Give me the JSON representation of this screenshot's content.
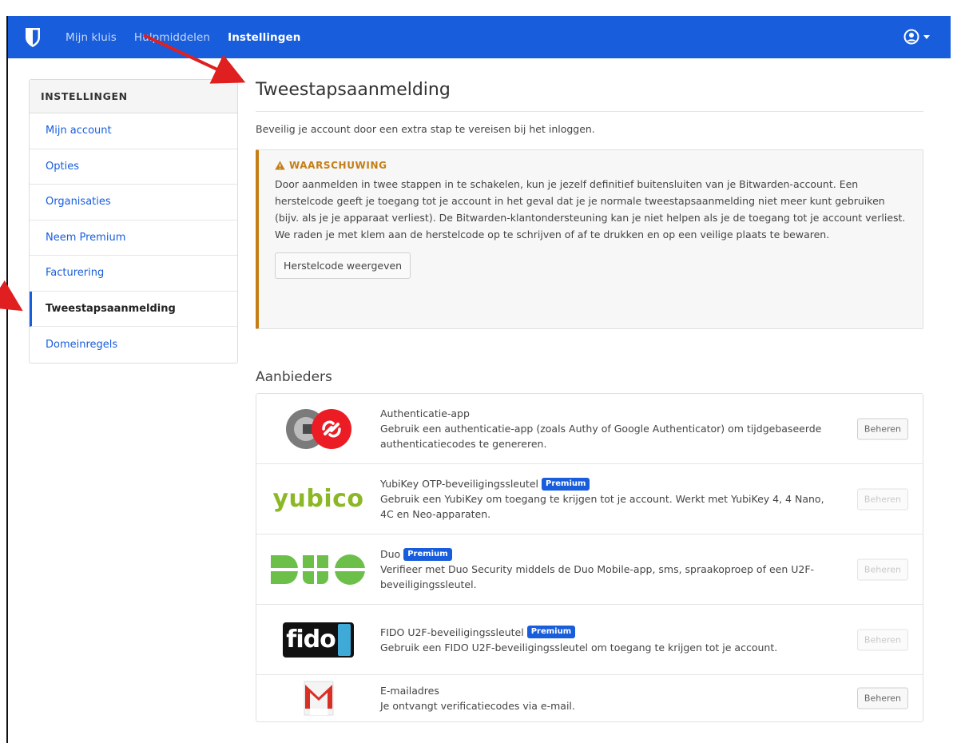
{
  "nav": {
    "links": [
      "Mijn kluis",
      "Hulpmiddelen",
      "Instellingen"
    ],
    "active": "Instellingen"
  },
  "sidebar": {
    "heading": "INSTELLINGEN",
    "items": [
      {
        "label": "Mijn account"
      },
      {
        "label": "Opties"
      },
      {
        "label": "Organisaties"
      },
      {
        "label": "Neem Premium"
      },
      {
        "label": "Facturering"
      },
      {
        "label": "Tweestapsaanmelding",
        "active": true
      },
      {
        "label": "Domeinregels"
      }
    ]
  },
  "main": {
    "title": "Tweestapsaanmelding",
    "description": "Beveilig je account door een extra stap te vereisen bij het inloggen.",
    "warning": {
      "title": "WAARSCHUWING",
      "text": "Door aanmelden in twee stappen in te schakelen, kun je jezelf definitief buitensluiten van je Bitwarden-account. Een herstelcode geeft je toegang tot je account in het geval dat je je normale tweestapsaanmelding niet meer kunt gebruiken (bijv. als je je apparaat verliest). De Bitwarden-klantondersteuning kan je niet helpen als je de toegang tot je account verliest. We raden je met klem aan de herstelcode op te schrijven of af te drukken en op een veilige plaats te bewaren.",
      "button": "Herstelcode weergeven"
    },
    "providers_title": "Aanbieders",
    "providers": [
      {
        "name": "Authenticatie-app",
        "premium": false,
        "desc": "Gebruik een authenticatie-app (zoals Authy of Google Authenticator) om tijdgebaseerde authenticatiecodes te genereren.",
        "button": "Beheren",
        "enabled": true,
        "logo": "authy-google-icon"
      },
      {
        "name": "YubiKey OTP-beveiligingssleutel",
        "premium": true,
        "desc": "Gebruik een YubiKey om toegang te krijgen tot je account. Werkt met YubiKey 4, 4 Nano, 4C en Neo-apparaten.",
        "button": "Beheren",
        "enabled": false,
        "logo_text": "yubico"
      },
      {
        "name": "Duo",
        "premium": true,
        "desc": "Verifieer met Duo Security middels de Duo Mobile-app, sms, spraakoproep of een U2F-beveiligingssleutel.",
        "button": "Beheren",
        "enabled": false,
        "logo": "duo-logo"
      },
      {
        "name": "FIDO U2F-beveiligingssleutel",
        "premium": true,
        "desc": "Gebruik een FIDO U2F-beveiligingssleutel om toegang te krijgen tot je account.",
        "button": "Beheren",
        "enabled": false,
        "logo_text": "fido"
      },
      {
        "name": "E-mailadres",
        "premium": false,
        "desc": "Je ontvangt verificatiecodes via e-mail.",
        "button": "Beheren",
        "enabled": true,
        "logo": "gmail-icon"
      }
    ],
    "premium_badge": "Premium"
  },
  "colors": {
    "brand": "#175ddc",
    "warning": "#c57e15",
    "annotation": "#e02020"
  }
}
